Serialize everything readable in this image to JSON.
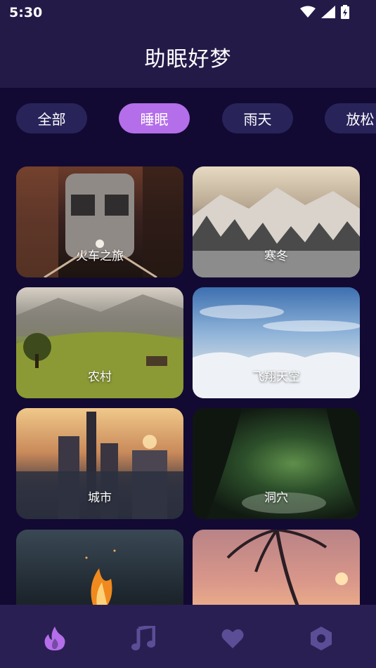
{
  "status": {
    "time": "5:30"
  },
  "header": {
    "title": "助眠好梦"
  },
  "categories": [
    {
      "label": "全部",
      "active": false
    },
    {
      "label": "睡眠",
      "active": true
    },
    {
      "label": "雨天",
      "active": false
    },
    {
      "label": "放松",
      "active": false
    }
  ],
  "cards": [
    {
      "label": "火车之旅"
    },
    {
      "label": "寒冬"
    },
    {
      "label": "农村"
    },
    {
      "label": "飞翔天空"
    },
    {
      "label": "城市"
    },
    {
      "label": "洞穴"
    },
    {
      "label": ""
    },
    {
      "label": ""
    }
  ],
  "bottom_nav": [
    {
      "icon": "flame-icon",
      "active": true
    },
    {
      "icon": "music-note-icon",
      "active": false
    },
    {
      "icon": "heart-icon",
      "active": false
    },
    {
      "icon": "hexagon-icon",
      "active": false
    }
  ],
  "colors": {
    "accent": "#b46ee9",
    "chip": "#28245a",
    "background": "#120a33",
    "bar": "#241a48"
  }
}
